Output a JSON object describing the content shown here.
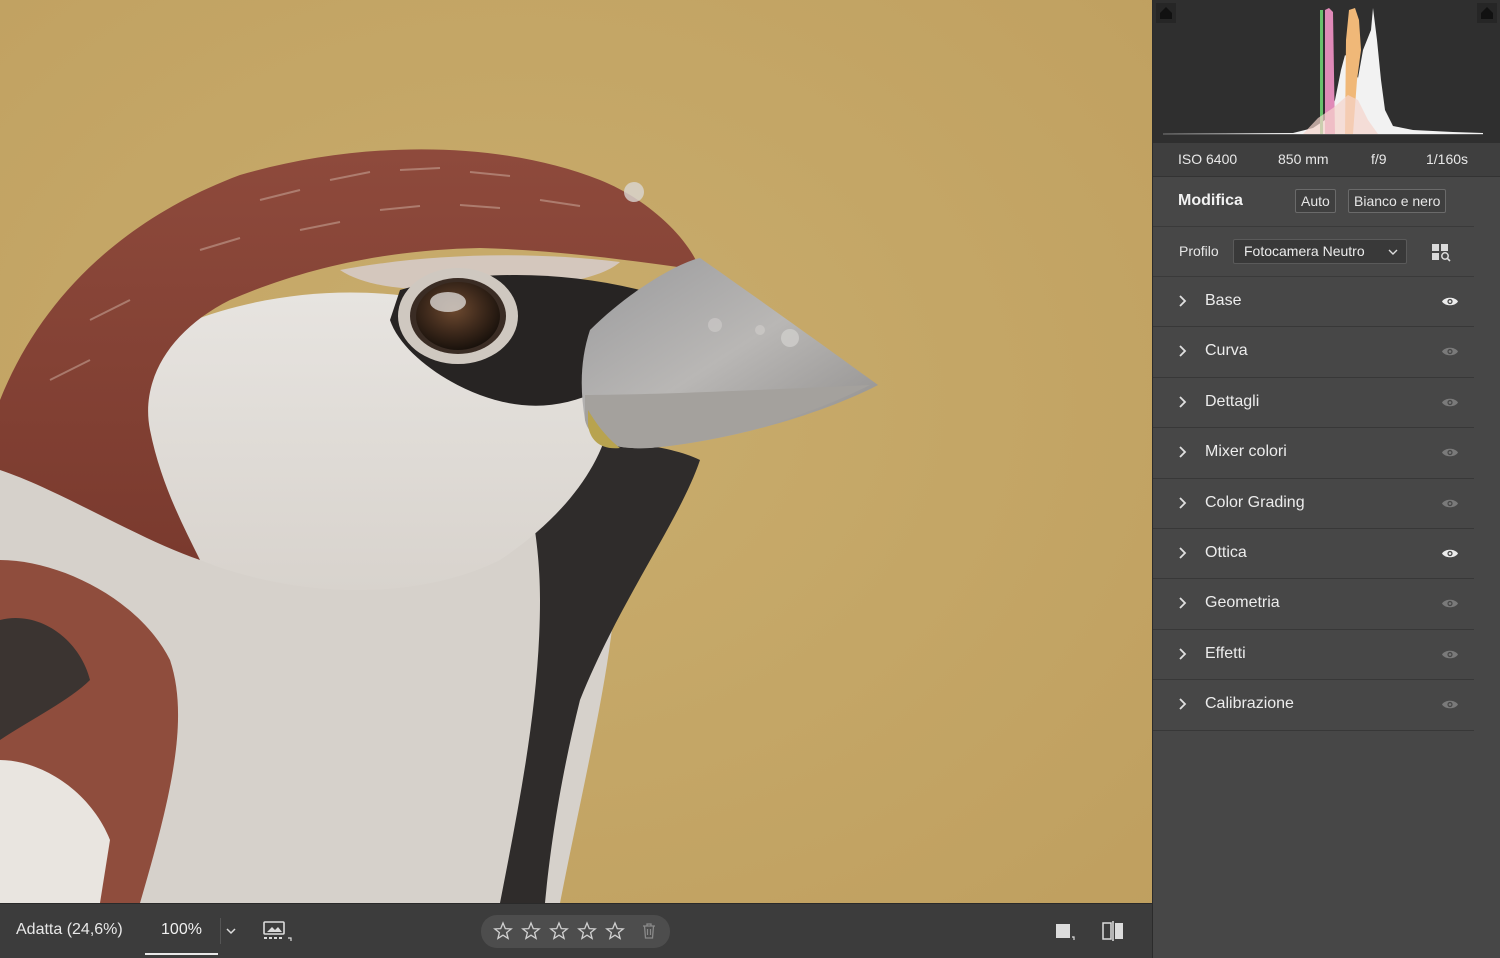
{
  "toolbar": {
    "zoom_fit_label": "Adatta (24,6%)",
    "zoom_100_label": "100%",
    "rating_stars": 0,
    "rating_max": 5
  },
  "exif": {
    "iso": "ISO 6400",
    "focal_length": "850 mm",
    "aperture": "f/9",
    "shutter": "1/160s"
  },
  "edit": {
    "title": "Modifica",
    "auto_label": "Auto",
    "bw_label": "Bianco e nero",
    "profile_label": "Profilo",
    "profile_value": "Fotocamera Neutro"
  },
  "sections": [
    {
      "label": "Base",
      "eye": "active"
    },
    {
      "label": "Curva",
      "eye": "inactive"
    },
    {
      "label": "Dettagli",
      "eye": "inactive"
    },
    {
      "label": "Mixer colori",
      "eye": "inactive"
    },
    {
      "label": "Color Grading",
      "eye": "inactive"
    },
    {
      "label": "Ottica",
      "eye": "active"
    },
    {
      "label": "Geometria",
      "eye": "inactive"
    },
    {
      "label": "Effetti",
      "eye": "inactive"
    },
    {
      "label": "Calibrazione",
      "eye": "inactive"
    }
  ],
  "colors": {
    "panel_bg": "#474747",
    "histogram_bg": "#2f2f2f",
    "photo_bg": "#c3a566",
    "text": "#ececec"
  }
}
